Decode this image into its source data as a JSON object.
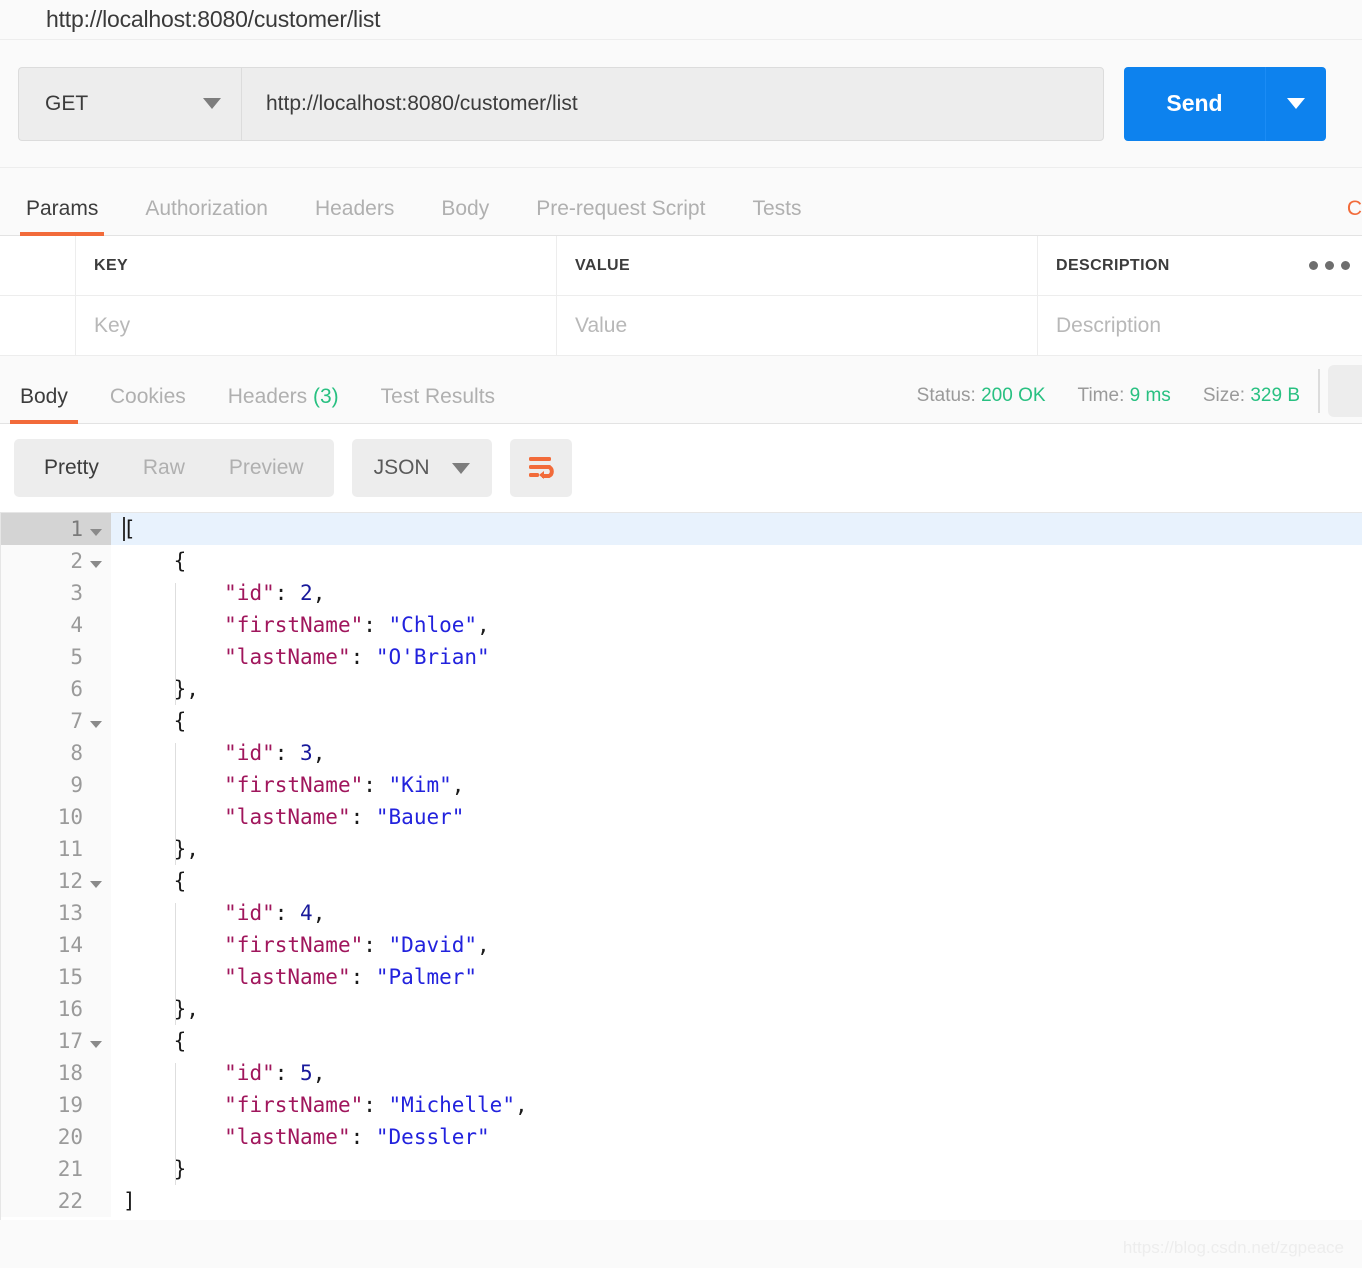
{
  "window": {
    "title": "http://localhost:8080/customer/list"
  },
  "request": {
    "method": "GET",
    "url": "http://localhost:8080/customer/list",
    "send_label": "Send",
    "tabs": [
      {
        "label": "Params",
        "active": true
      },
      {
        "label": "Authorization",
        "active": false
      },
      {
        "label": "Headers",
        "active": false
      },
      {
        "label": "Body",
        "active": false
      },
      {
        "label": "Pre-request Script",
        "active": false
      },
      {
        "label": "Tests",
        "active": false
      }
    ],
    "code_link": "C"
  },
  "params": {
    "columns": [
      "KEY",
      "VALUE",
      "DESCRIPTION"
    ],
    "row_placeholders": {
      "key": "Key",
      "value": "Value",
      "description": "Description"
    }
  },
  "response": {
    "tabs": [
      {
        "label": "Body",
        "active": true,
        "count": ""
      },
      {
        "label": "Cookies",
        "active": false,
        "count": ""
      },
      {
        "label": "Headers",
        "active": false,
        "count": "(3)"
      },
      {
        "label": "Test Results",
        "active": false,
        "count": ""
      }
    ],
    "stats": {
      "status_label": "Status:",
      "status_value": "200 OK",
      "time_label": "Time:",
      "time_value": "9 ms",
      "size_label": "Size:",
      "size_value": "329 B"
    },
    "toolbar": {
      "views": [
        {
          "label": "Pretty",
          "active": true
        },
        {
          "label": "Raw",
          "active": false
        },
        {
          "label": "Preview",
          "active": false
        }
      ],
      "format": "JSON",
      "wrap_icon": "word-wrap-icon"
    }
  },
  "colors": {
    "accent_orange": "#f26b3a",
    "send_blue": "#0d82ee",
    "status_green": "#28c081",
    "json_key": "#a0165c",
    "json_string": "#2222dd",
    "json_number": "#18199b"
  },
  "code": {
    "lines": [
      {
        "n": "1",
        "fold": true,
        "active": true,
        "cursor": true,
        "tokens": [
          {
            "t": "[",
            "c": "punc"
          }
        ]
      },
      {
        "n": "2",
        "fold": true,
        "active": false,
        "indent": 1,
        "tokens": [
          {
            "t": "{",
            "c": "punc"
          }
        ]
      },
      {
        "n": "3",
        "fold": false,
        "active": false,
        "indent": 2,
        "tokens": [
          {
            "t": "\"id\"",
            "c": "key"
          },
          {
            "t": ": ",
            "c": "punc"
          },
          {
            "t": "2",
            "c": "num"
          },
          {
            "t": ",",
            "c": "punc"
          }
        ]
      },
      {
        "n": "4",
        "fold": false,
        "active": false,
        "indent": 2,
        "tokens": [
          {
            "t": "\"firstName\"",
            "c": "key"
          },
          {
            "t": ": ",
            "c": "punc"
          },
          {
            "t": "\"Chloe\"",
            "c": "str"
          },
          {
            "t": ",",
            "c": "punc"
          }
        ]
      },
      {
        "n": "5",
        "fold": false,
        "active": false,
        "indent": 2,
        "tokens": [
          {
            "t": "\"lastName\"",
            "c": "key"
          },
          {
            "t": ": ",
            "c": "punc"
          },
          {
            "t": "\"O'Brian\"",
            "c": "str"
          }
        ]
      },
      {
        "n": "6",
        "fold": false,
        "active": false,
        "indent": 1,
        "tokens": [
          {
            "t": "},",
            "c": "punc"
          }
        ]
      },
      {
        "n": "7",
        "fold": true,
        "active": false,
        "indent": 1,
        "tokens": [
          {
            "t": "{",
            "c": "punc"
          }
        ]
      },
      {
        "n": "8",
        "fold": false,
        "active": false,
        "indent": 2,
        "tokens": [
          {
            "t": "\"id\"",
            "c": "key"
          },
          {
            "t": ": ",
            "c": "punc"
          },
          {
            "t": "3",
            "c": "num"
          },
          {
            "t": ",",
            "c": "punc"
          }
        ]
      },
      {
        "n": "9",
        "fold": false,
        "active": false,
        "indent": 2,
        "tokens": [
          {
            "t": "\"firstName\"",
            "c": "key"
          },
          {
            "t": ": ",
            "c": "punc"
          },
          {
            "t": "\"Kim\"",
            "c": "str"
          },
          {
            "t": ",",
            "c": "punc"
          }
        ]
      },
      {
        "n": "10",
        "fold": false,
        "active": false,
        "indent": 2,
        "tokens": [
          {
            "t": "\"lastName\"",
            "c": "key"
          },
          {
            "t": ": ",
            "c": "punc"
          },
          {
            "t": "\"Bauer\"",
            "c": "str"
          }
        ]
      },
      {
        "n": "11",
        "fold": false,
        "active": false,
        "indent": 1,
        "tokens": [
          {
            "t": "},",
            "c": "punc"
          }
        ]
      },
      {
        "n": "12",
        "fold": true,
        "active": false,
        "indent": 1,
        "tokens": [
          {
            "t": "{",
            "c": "punc"
          }
        ]
      },
      {
        "n": "13",
        "fold": false,
        "active": false,
        "indent": 2,
        "tokens": [
          {
            "t": "\"id\"",
            "c": "key"
          },
          {
            "t": ": ",
            "c": "punc"
          },
          {
            "t": "4",
            "c": "num"
          },
          {
            "t": ",",
            "c": "punc"
          }
        ]
      },
      {
        "n": "14",
        "fold": false,
        "active": false,
        "indent": 2,
        "tokens": [
          {
            "t": "\"firstName\"",
            "c": "key"
          },
          {
            "t": ": ",
            "c": "punc"
          },
          {
            "t": "\"David\"",
            "c": "str"
          },
          {
            "t": ",",
            "c": "punc"
          }
        ]
      },
      {
        "n": "15",
        "fold": false,
        "active": false,
        "indent": 2,
        "tokens": [
          {
            "t": "\"lastName\"",
            "c": "key"
          },
          {
            "t": ": ",
            "c": "punc"
          },
          {
            "t": "\"Palmer\"",
            "c": "str"
          }
        ]
      },
      {
        "n": "16",
        "fold": false,
        "active": false,
        "indent": 1,
        "tokens": [
          {
            "t": "},",
            "c": "punc"
          }
        ]
      },
      {
        "n": "17",
        "fold": true,
        "active": false,
        "indent": 1,
        "tokens": [
          {
            "t": "{",
            "c": "punc"
          }
        ]
      },
      {
        "n": "18",
        "fold": false,
        "active": false,
        "indent": 2,
        "tokens": [
          {
            "t": "\"id\"",
            "c": "key"
          },
          {
            "t": ": ",
            "c": "punc"
          },
          {
            "t": "5",
            "c": "num"
          },
          {
            "t": ",",
            "c": "punc"
          }
        ]
      },
      {
        "n": "19",
        "fold": false,
        "active": false,
        "indent": 2,
        "tokens": [
          {
            "t": "\"firstName\"",
            "c": "key"
          },
          {
            "t": ": ",
            "c": "punc"
          },
          {
            "t": "\"Michelle\"",
            "c": "str"
          },
          {
            "t": ",",
            "c": "punc"
          }
        ]
      },
      {
        "n": "20",
        "fold": false,
        "active": false,
        "indent": 2,
        "tokens": [
          {
            "t": "\"lastName\"",
            "c": "key"
          },
          {
            "t": ": ",
            "c": "punc"
          },
          {
            "t": "\"Dessler\"",
            "c": "str"
          }
        ]
      },
      {
        "n": "21",
        "fold": false,
        "active": false,
        "indent": 1,
        "tokens": [
          {
            "t": "}",
            "c": "punc"
          }
        ]
      },
      {
        "n": "22",
        "fold": false,
        "active": false,
        "indent": 0,
        "tokens": [
          {
            "t": "]",
            "c": "punc"
          }
        ]
      }
    ]
  },
  "watermark": "https://blog.csdn.net/zgpeace"
}
